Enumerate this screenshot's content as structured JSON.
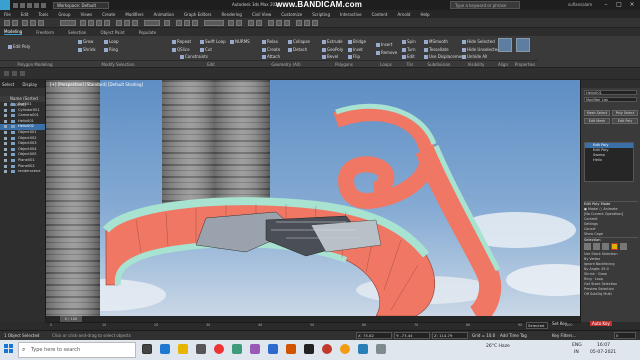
{
  "title_bar": {
    "workspace": "Workspace: Default",
    "app_title": "Autodesk 3ds Max 2020",
    "recorder": "www.BANDICAM.com",
    "search_placeholder": "Type a keyword or phrase",
    "user": "sufiansalam"
  },
  "menu": [
    "File",
    "Edit",
    "Tools",
    "Group",
    "Views",
    "Create",
    "Modifiers",
    "Animation",
    "Graph Editors",
    "Rendering",
    "Civil View",
    "Customize",
    "Scripting",
    "Interactive",
    "Content",
    "Arnold",
    "Help"
  ],
  "ribbon_tabs": [
    "Modeling",
    "Freeform",
    "Selection",
    "Object Paint",
    "Populate"
  ],
  "ribbon": {
    "edit_poly": "Edit Poly",
    "groups": [
      "Polygon Modeling",
      "Modify Selection",
      "Edit",
      "Geometry (All)",
      "Polygons",
      "Loops",
      "Tris",
      "Subdivision",
      "Visibility",
      "Align",
      "Properties"
    ],
    "modify_selection": [
      "Grow",
      "Shrink",
      "Loop",
      "Ring"
    ],
    "edit": [
      "Repeat",
      "QSlice",
      "Swift Loop",
      "Cut",
      "NURMS",
      "Constraints"
    ],
    "geometry": [
      "Relax",
      "Create",
      "Attach",
      "Collapse",
      "Detach"
    ],
    "polygons": [
      "Extrude",
      "GeoPoly",
      "Bevel",
      "Bridge",
      "Inset",
      "Flip"
    ],
    "loops": [
      "Insert",
      "Remove"
    ],
    "tris": [
      "Spin",
      "Turn",
      "Edit"
    ],
    "subdivision": [
      "MSmooth",
      "Tessellate",
      "Use Displacement"
    ],
    "visibility": [
      "Hide Selected",
      "Hide Unselected",
      "Unhide All"
    ],
    "align_label": "Align",
    "properties_label": "Properties"
  },
  "explorer": {
    "tabs": [
      "Select",
      "Display"
    ],
    "header": "Name (Sorted Ascend)",
    "rows": [
      "Box001",
      "Cylinder001",
      "Camera001",
      "Helix001",
      "Helix002",
      "Object001",
      "Object002",
      "Object003",
      "Object004",
      "Object005",
      "Plane001",
      "Plane002",
      "renderscene"
    ]
  },
  "viewport": {
    "label": "[+] [Perspective] [Standard] [Default Shading]"
  },
  "command_panel": {
    "object_name": "Helix001",
    "modifier_list": "Modifier List",
    "buttons": [
      "Mesh Select",
      "Poly Select",
      "Edit Mesh",
      "Edit Poly"
    ],
    "stack": [
      "Edit Poly",
      "Edit Poly",
      "Sweep",
      "Helix"
    ],
    "rollout": "Edit Poly Mode",
    "mode_model": "Model",
    "mode_animate": "Animate",
    "no_op": "[No Current Operation]",
    "commit": "Commit",
    "settings": "Settings",
    "cancel": "Cancel",
    "show_cage": "Show Cage",
    "selection_header": "Selection",
    "selection_opts": [
      "Use Stack Selection",
      "By Vertex",
      "Ignore Backfacing",
      "By Angle: 45.0"
    ],
    "shrink": "Shrink",
    "grow": "Grow",
    "ring": "Ring",
    "loop": "Loop",
    "get_stack": "Get Stack Selection",
    "preview": "Preview Selection",
    "off": "Off",
    "subobj": "SubObj",
    "multi": "Multi"
  },
  "timeline": {
    "frame": "0 / 100",
    "ticks": [
      "0",
      "10",
      "20",
      "30",
      "40",
      "50",
      "60",
      "70",
      "80",
      "90",
      "100"
    ]
  },
  "status": {
    "prompt": "1 Object Selected",
    "hint": "Click or click-and-drag to select objects",
    "x": "X: 75.82",
    "y": "Y: -73.44",
    "z": "Z: 114.79",
    "grid": "Grid = 10.0",
    "add_tag": "Add Time Tag",
    "autokey": "Auto Key",
    "selected": "Selected",
    "setkey": "Set Key",
    "filters": "Key Filters...",
    "frame_field": "0"
  },
  "taskbar": {
    "search": "Type here to search",
    "temp": "26°C Haze",
    "lang": "ENG",
    "region": "IN",
    "time": "16:07",
    "date": "05-07-2021"
  },
  "colors": {
    "accent": "#3aa0d0",
    "ribbon_surface": "#ef7763",
    "ribbon_edge": "#a8e3d2",
    "building_panels": "#6a6a6a",
    "sky": "#7ea6d2",
    "autokey_red": "#c03232"
  }
}
